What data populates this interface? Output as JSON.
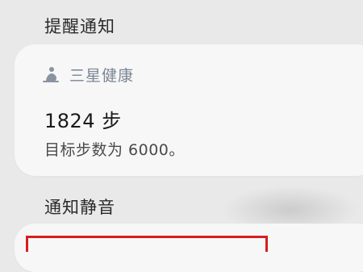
{
  "sections": {
    "reminder_header": "提醒通知",
    "mute_header": "通知静音"
  },
  "notification": {
    "app_icon": "samsung-health-icon",
    "app_name": "三星健康",
    "steps": "1824 步",
    "goal": "目标步数为 6000。"
  },
  "colors": {
    "background": "#e9e9e9",
    "card": "#f7f7f7",
    "app_name": "#7b8594",
    "highlight_frame": "#d32020"
  }
}
